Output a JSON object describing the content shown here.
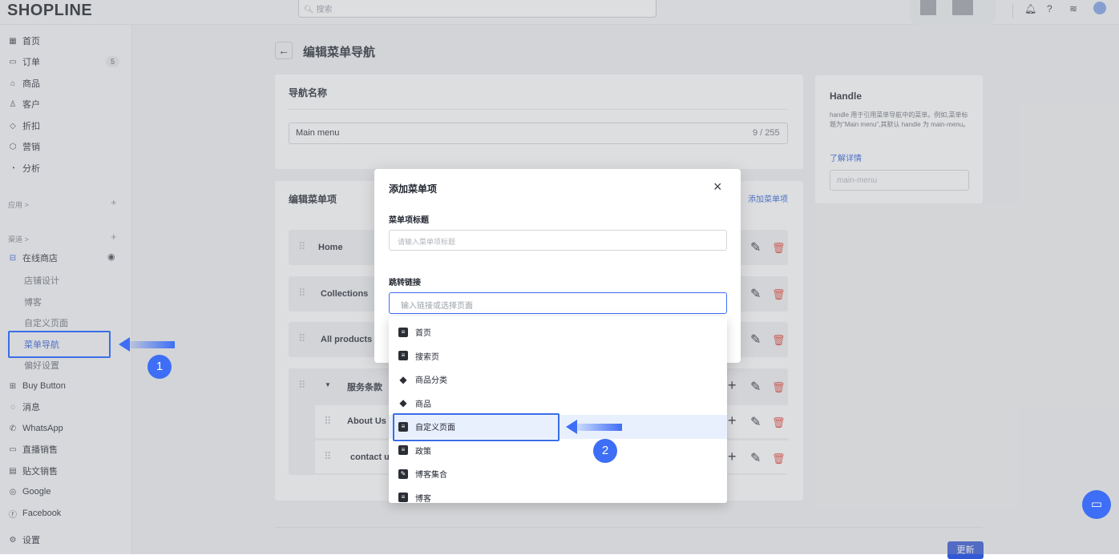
{
  "topbar": {
    "logo": "SHOPLINE",
    "search_placeholder": "搜索"
  },
  "sidebar": {
    "main_items": [
      {
        "label": "首页",
        "icon": "home-icon"
      },
      {
        "label": "订单",
        "icon": "order-icon",
        "badge": "5"
      },
      {
        "label": "商品",
        "icon": "product-icon"
      },
      {
        "label": "客户",
        "icon": "customer-icon"
      },
      {
        "label": "折扣",
        "icon": "discount-icon"
      },
      {
        "label": "营销",
        "icon": "marketing-icon"
      },
      {
        "label": "分析",
        "icon": "analytics-icon"
      }
    ],
    "apps_label": "应用 >",
    "channels_label": "渠道 >",
    "online_store": "在线商店",
    "store_sub": [
      "店铺设计",
      "博客",
      "自定义页面",
      "菜单导航",
      "偏好设置"
    ],
    "channels": [
      "Buy Button",
      "消息",
      "WhatsApp",
      "直播销售",
      "贴文销售",
      "Google",
      "Facebook"
    ],
    "settings": "设置"
  },
  "page": {
    "title": "编辑菜单导航",
    "nav_name_heading": "导航名称",
    "nav_name_value": "Main menu",
    "nav_name_count": "9 / 255",
    "edit_items_heading": "编辑菜单项",
    "add_item_link": "添加菜单项",
    "items": [
      "Home",
      "Collections",
      "All products",
      "服务条款",
      "About Us",
      "contact u"
    ],
    "update_button": "更新"
  },
  "handle": {
    "title": "Handle",
    "desc": "handle 用于引用菜单导航中的菜单。例如,菜单标题为\"Main menu\",其默认 handle 为 main-menu。",
    "link": "了解详情",
    "placeholder": "main-menu"
  },
  "modal": {
    "title": "添加菜单项",
    "title_label": "菜单项标题",
    "title_placeholder": "请输入菜单项标题",
    "link_label": "跳转链接",
    "link_placeholder": "输入链接或选择页面",
    "options": [
      "首页",
      "搜索页",
      "商品分类",
      "商品",
      "自定义页面",
      "政策",
      "博客集合",
      "博客"
    ]
  },
  "annotations": {
    "step1": "1",
    "step2": "2",
    "accent": "#3d6ef5"
  }
}
